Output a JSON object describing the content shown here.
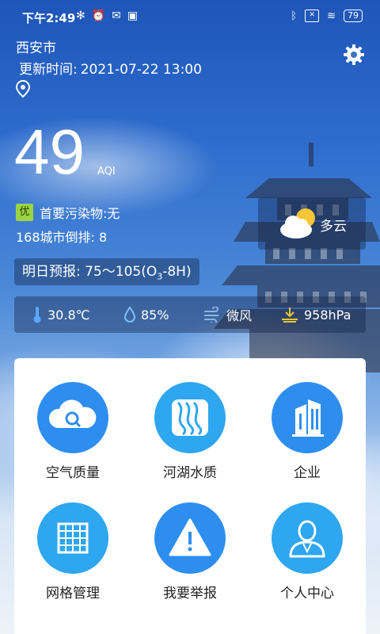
{
  "status_bar": {
    "time": "下午2:49",
    "battery": "79"
  },
  "location": {
    "city": "西安市",
    "update_label": "更新时间:",
    "update_time": "2021-07-22 13:00"
  },
  "aqi": {
    "value": "49",
    "unit": "AQI",
    "level": "优",
    "level_color": "#9ad442",
    "primary_pollutant": "首要污染物:无",
    "rank": "168城市倒排:  8"
  },
  "forecast": {
    "label": "明日预报:",
    "range": "75～105(O",
    "sub": "3",
    "tail": "-8H)"
  },
  "weather": {
    "condition": "多云"
  },
  "metrics": {
    "temperature": "30.8℃",
    "humidity": "85%",
    "wind": "微风",
    "pressure": "958hPa"
  },
  "menu": [
    {
      "label": "空气质量",
      "icon": "cloud-search-icon",
      "color": "#2e8ef0"
    },
    {
      "label": "河湖水质",
      "icon": "water-waves-icon",
      "color": "#2ea6f0"
    },
    {
      "label": "企业",
      "icon": "building-icon",
      "color": "#2e8ef0"
    },
    {
      "label": "网格管理",
      "icon": "grid-icon",
      "color": "#2ea6f0"
    },
    {
      "label": "我要举报",
      "icon": "warning-icon",
      "color": "#2e8ef0"
    },
    {
      "label": "个人中心",
      "icon": "person-icon",
      "color": "#2ea6f0"
    }
  ]
}
